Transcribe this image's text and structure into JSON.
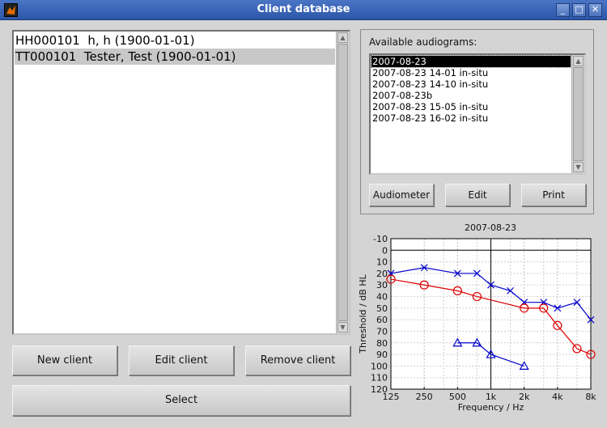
{
  "window": {
    "title": "Client database",
    "controls": [
      "_",
      "□",
      "✕"
    ]
  },
  "clients": [
    {
      "label": "HH000101  h, h (1900-01-01)",
      "selected": false
    },
    {
      "label": "TT000101  Tester, Test (1900-01-01)",
      "selected": true
    }
  ],
  "client_buttons": {
    "new": "New client",
    "edit": "Edit client",
    "remove": "Remove client",
    "select": "Select"
  },
  "audiograms": {
    "label": "Available audiograms:",
    "items": [
      {
        "label": "2007-08-23",
        "selected": true
      },
      {
        "label": "2007-08-23 14-01 in-situ",
        "selected": false
      },
      {
        "label": "2007-08-23 14-10 in-situ",
        "selected": false
      },
      {
        "label": "2007-08-23b",
        "selected": false
      },
      {
        "label": "2007-08-23 15-05 in-situ",
        "selected": false
      },
      {
        "label": "2007-08-23 16-02 in-situ",
        "selected": false
      }
    ],
    "buttons": {
      "audiometer": "Audiometer",
      "edit": "Edit",
      "print": "Print"
    }
  },
  "chart_data": {
    "type": "line",
    "title": "2007-08-23",
    "xlabel": "Frequency / Hz",
    "ylabel": "Threshold / dB HL",
    "x_scale": "log",
    "xlim": [
      125,
      8000
    ],
    "x_ticks": [
      125,
      250,
      500,
      1000,
      2000,
      4000,
      8000
    ],
    "x_tick_labels": [
      "125",
      "250",
      "500",
      "1k",
      "2k",
      "4k",
      "8k"
    ],
    "ylim": [
      -10,
      120
    ],
    "y_inverted": true,
    "y_ticks": [
      -10,
      0,
      10,
      20,
      30,
      40,
      50,
      60,
      70,
      80,
      90,
      100,
      110,
      120
    ],
    "grid": true,
    "series": [
      {
        "marker": "x",
        "color": "#0000cc",
        "x": [
          125,
          250,
          500,
          750,
          1000,
          1500,
          2000,
          3000,
          4000,
          6000,
          8000
        ],
        "y": [
          20,
          15,
          20,
          20,
          30,
          35,
          45,
          45,
          50,
          45,
          60
        ]
      },
      {
        "marker": "o",
        "color": "#dd0000",
        "x": [
          125,
          250,
          500,
          750,
          2000,
          3000,
          4000,
          6000,
          8000
        ],
        "y": [
          25,
          30,
          35,
          40,
          50,
          50,
          65,
          85,
          90
        ]
      },
      {
        "marker": "triangle",
        "color": "#0000cc",
        "x": [
          500,
          750,
          1000,
          2000
        ],
        "y": [
          80,
          80,
          90,
          100
        ]
      }
    ]
  }
}
